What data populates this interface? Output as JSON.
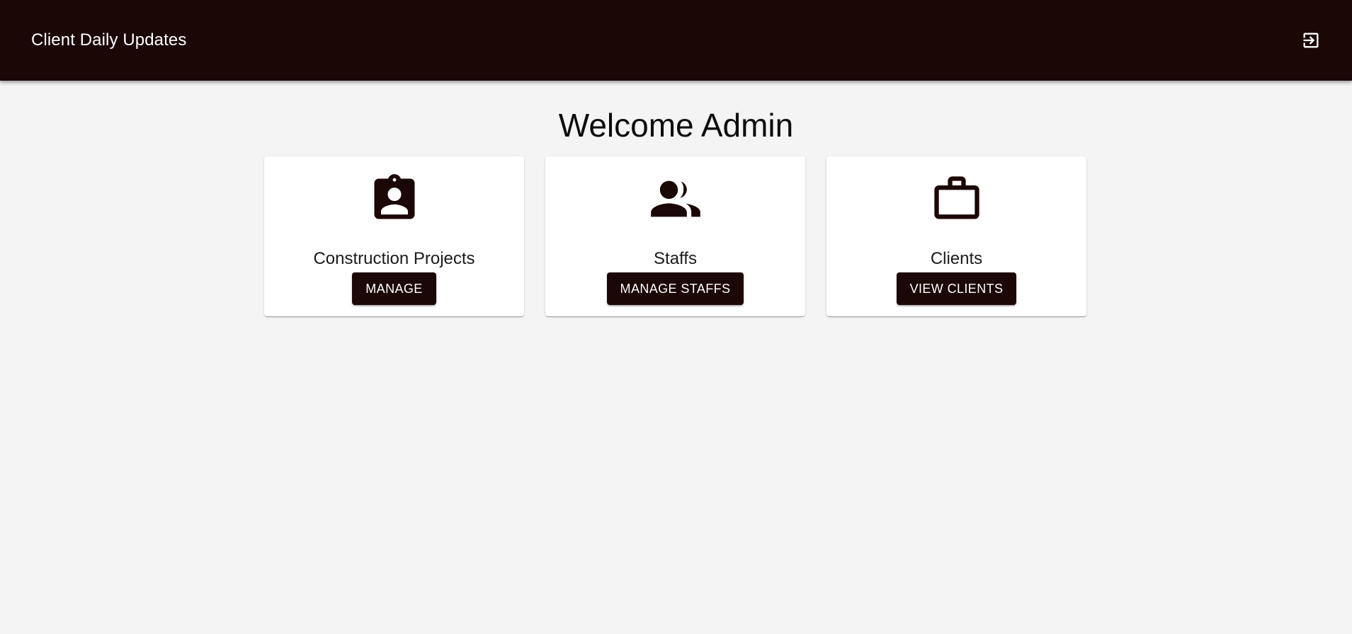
{
  "header": {
    "title": "Client Daily Updates",
    "logout_icon": "logout-icon",
    "background": "#1b0706"
  },
  "main": {
    "title": "Welcome Admin",
    "cards": [
      {
        "icon": "contact-badge-icon",
        "title": "Construction Projects",
        "button": "MANAGE"
      },
      {
        "icon": "people-icon",
        "title": "Staffs",
        "button": "MANAGE STAFFS"
      },
      {
        "icon": "briefcase-icon",
        "title": "Clients",
        "button": "VIEW CLIENTS"
      }
    ]
  },
  "colors": {
    "primary": "#1b0706",
    "page_background": "#f4f4f4",
    "card_background": "#ffffff"
  }
}
